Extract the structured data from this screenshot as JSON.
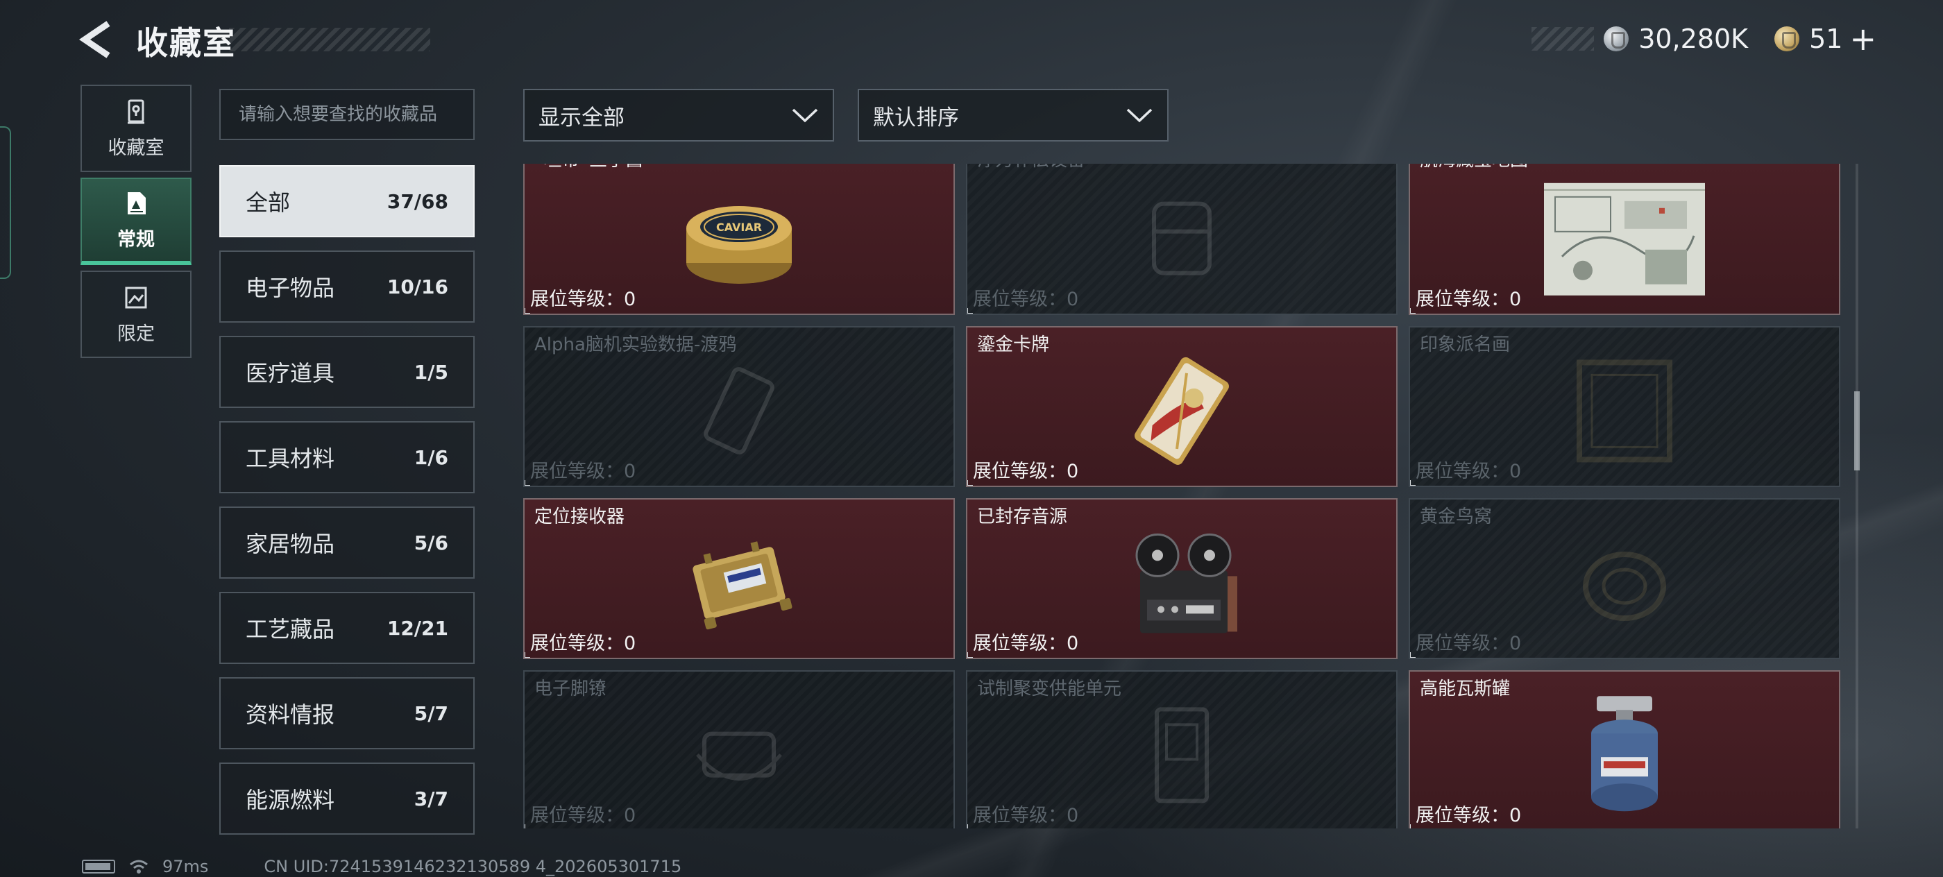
{
  "header": {
    "title": "收藏室",
    "currencies": [
      {
        "icon": "silver-coin-icon",
        "value": "30,280K"
      },
      {
        "icon": "gold-coin-icon",
        "value": "51"
      }
    ],
    "plus_label": "+"
  },
  "side_tabs": [
    {
      "label": "收藏室",
      "icon": "vault-icon",
      "active": false
    },
    {
      "label": "常规",
      "icon": "document-icon",
      "active": true
    },
    {
      "label": "限定",
      "icon": "picture-icon",
      "active": false
    }
  ],
  "search": {
    "placeholder": "请输入想要查找的收藏品"
  },
  "categories": [
    {
      "name": "全部",
      "count": "37/68",
      "active": true
    },
    {
      "name": "电子物品",
      "count": "10/16"
    },
    {
      "name": "医疗道具",
      "count": "1/5"
    },
    {
      "name": "工具材料",
      "count": "1/6"
    },
    {
      "name": "家居物品",
      "count": "5/6"
    },
    {
      "name": "工艺藏品",
      "count": "12/21"
    },
    {
      "name": "资料情报",
      "count": "5/7"
    },
    {
      "name": "能源燃料",
      "count": "3/7"
    }
  ],
  "filters": {
    "display": "显示全部",
    "sort": "默认排序"
  },
  "level_label": "展位等级：",
  "items": [
    {
      "name": "“坦帝”鱼子酱",
      "level": "0",
      "owned": true,
      "icon": "caviar-tin-icon"
    },
    {
      "name": "浮力补偿设备",
      "level": "0",
      "owned": false,
      "icon": "diving-gear-icon"
    },
    {
      "name": "航海藏宝地图",
      "level": "0",
      "owned": true,
      "icon": "map-document-icon"
    },
    {
      "name": "Alpha脑机实验数据-渡鸦",
      "level": "0",
      "owned": false,
      "icon": "data-drive-icon"
    },
    {
      "name": "鎏金卡牌",
      "level": "0",
      "owned": true,
      "icon": "gilded-card-icon"
    },
    {
      "name": "印象派名画",
      "level": "0",
      "owned": false,
      "icon": "painting-icon"
    },
    {
      "name": "定位接收器",
      "level": "0",
      "owned": true,
      "icon": "receiver-device-icon"
    },
    {
      "name": "已封存音源",
      "level": "0",
      "owned": true,
      "icon": "reel-recorder-icon"
    },
    {
      "name": "黄金鸟窝",
      "level": "0",
      "owned": false,
      "icon": "bird-nest-icon"
    },
    {
      "name": "电子脚镣",
      "level": "0",
      "owned": false,
      "icon": "ankle-monitor-icon"
    },
    {
      "name": "试制聚变供能单元",
      "level": "0",
      "owned": false,
      "icon": "fusion-cell-icon"
    },
    {
      "name": "高能瓦斯罐",
      "level": "0",
      "owned": true,
      "icon": "gas-canister-icon"
    }
  ],
  "footer": {
    "ping": "97ms",
    "uid": "CN UID:7241539146232130589 4_202605301715"
  }
}
